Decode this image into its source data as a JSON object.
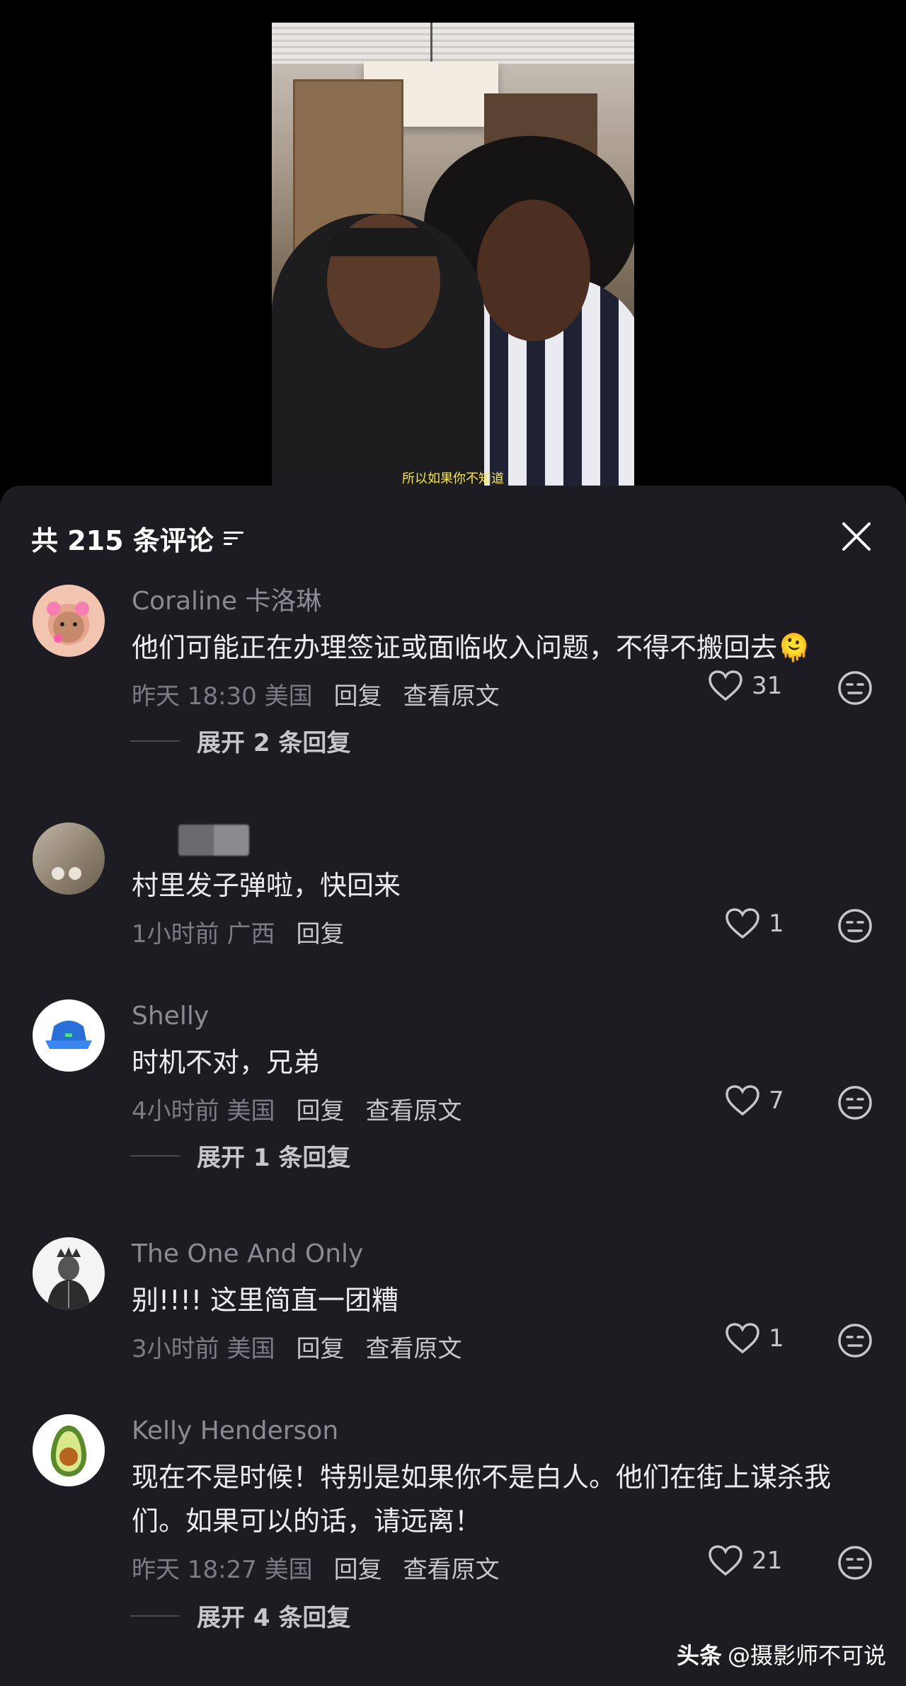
{
  "video": {
    "subtitle": "所以如果你不知道"
  },
  "header": {
    "title": "共 215 条评论"
  },
  "comments": [
    {
      "name": "Coraline 卡洛琳",
      "text": "他们可能正在办理签证或面临收入问题，不得不搬回去🫠",
      "time": "昨天 18:30 美国",
      "reply": "回复",
      "view_original": "查看原文",
      "likes": "31",
      "expand": "展开 2 条回复"
    },
    {
      "name": "",
      "text": "村里发子弹啦，快回来",
      "time": "1小时前 广西",
      "reply": "回复",
      "likes": "1"
    },
    {
      "name": "Shelly",
      "text": "时机不对，兄弟",
      "time": "4小时前 美国",
      "reply": "回复",
      "view_original": "查看原文",
      "likes": "7",
      "expand": "展开 1 条回复"
    },
    {
      "name": "The One And Only",
      "text": "别!!!! 这里简直一团糟",
      "time": "3小时前 美国",
      "reply": "回复",
      "view_original": "查看原文",
      "likes": "1"
    },
    {
      "name": "Kelly Henderson",
      "text": "现在不是时候！特别是如果你不是白人。他们在街上谋杀我们。如果可以的话，请远离！",
      "time": "昨天 18:27 美国",
      "reply": "回复",
      "view_original": "查看原文",
      "likes": "21",
      "expand": "展开 4 条回复"
    }
  ],
  "watermark": {
    "brand": "头条",
    "handle": "@摄影师不可说"
  },
  "colors": {
    "panel_bg": "#1c1c22",
    "page_bg": "#000000",
    "name_gray": "#8b8b93",
    "text_white": "#ececf0",
    "subtitle_yellow": "#f7e54a"
  }
}
